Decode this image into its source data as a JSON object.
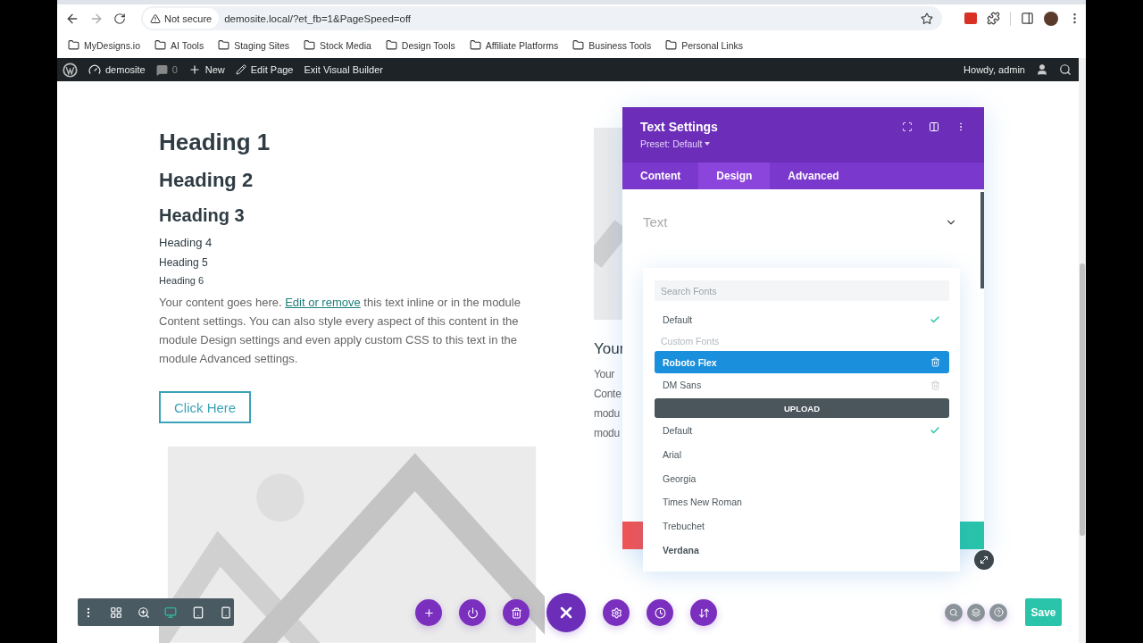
{
  "browser": {
    "security": "Not secure",
    "url": "demosite.local/?et_fb=1&PageSpeed=off"
  },
  "bookmarks": [
    "MyDesigns.io",
    "AI Tools",
    "Staging Sites",
    "Stock Media",
    "Design Tools",
    "Affiliate Platforms",
    "Business Tools",
    "Personal Links"
  ],
  "admin_bar": {
    "site": "demosite",
    "comments": "0",
    "new": "New",
    "edit": "Edit Page",
    "exit": "Exit Visual Builder",
    "greeting": "Howdy, admin"
  },
  "content": {
    "headings": [
      {
        "kind": "h1",
        "text": "Heading 1"
      },
      {
        "kind": "h2",
        "text": "Heading 2"
      },
      {
        "kind": "h3",
        "text": "Heading 3"
      },
      {
        "kind": "h4",
        "text": "Heading 4"
      },
      {
        "kind": "h5",
        "text": "Heading 5"
      },
      {
        "kind": "h6",
        "text": "Heading 6"
      }
    ],
    "paragraph": {
      "before": "Your content goes here. ",
      "link": "Edit or remove",
      "after": " this text inline or in the module Content settings. You can also style every aspect of this content in the module Design settings and even apply custom CSS to this text in the module Advanced settings."
    },
    "button": "Click Here",
    "side_heading": "Your",
    "side_lines": [
      "Your",
      "Conte",
      "modu",
      "modu"
    ]
  },
  "panel": {
    "title": "Text Settings",
    "preset": "Preset: Default",
    "tabs": [
      {
        "label": "Content",
        "selected": false
      },
      {
        "label": "Design",
        "selected": true
      },
      {
        "label": "Advanced",
        "selected": false
      }
    ],
    "section": "Text"
  },
  "font_menu": {
    "placeholder": "Search Fonts",
    "items": [
      {
        "kind": "font",
        "label": "Default",
        "checked": true,
        "selected": false,
        "bold": false
      },
      {
        "kind": "header",
        "label": "Custom Fonts"
      },
      {
        "kind": "custom",
        "label": "Roboto Flex",
        "selected": true
      },
      {
        "kind": "custom",
        "label": "DM Sans",
        "selected": false
      },
      {
        "kind": "upload",
        "label": "UPLOAD"
      },
      {
        "kind": "font",
        "label": "Default",
        "checked": true,
        "selected": false,
        "bold": false
      },
      {
        "kind": "font",
        "label": "Arial",
        "checked": false,
        "selected": false,
        "bold": false
      },
      {
        "kind": "font",
        "label": "Georgia",
        "checked": false,
        "selected": false,
        "bold": false
      },
      {
        "kind": "font",
        "label": "Times New Roman",
        "checked": false,
        "selected": false,
        "bold": false
      },
      {
        "kind": "font",
        "label": "Trebuchet",
        "checked": false,
        "selected": false,
        "bold": false
      },
      {
        "kind": "font",
        "label": "Verdana",
        "checked": false,
        "selected": false,
        "bold": true
      }
    ]
  },
  "view_modes": [
    {
      "kind": "wireframe",
      "selected": false
    },
    {
      "kind": "zoom",
      "selected": false
    },
    {
      "kind": "desktop",
      "selected": true
    },
    {
      "kind": "tablet",
      "selected": false
    },
    {
      "kind": "phone",
      "selected": false
    }
  ],
  "save": "Save"
}
